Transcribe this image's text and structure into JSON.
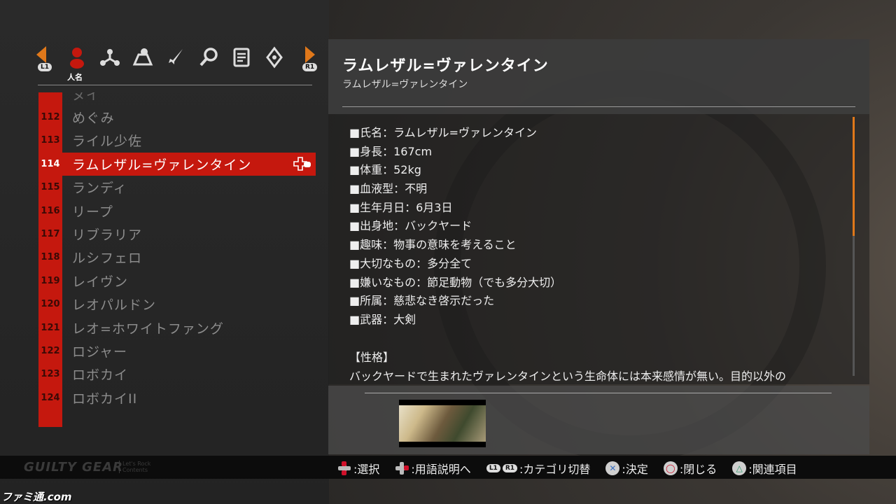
{
  "category_nav": {
    "left_button": "L1",
    "right_button": "R1",
    "active_label": "人名",
    "icons": [
      "person-icon",
      "network-icon",
      "map-icon",
      "sword-icon",
      "magnifier-icon",
      "document-icon",
      "hand-sign-icon"
    ]
  },
  "glossary_list": {
    "partial_top": "ヌイ",
    "items": [
      {
        "num": "112",
        "name": "めぐみ"
      },
      {
        "num": "113",
        "name": "ライル少佐"
      },
      {
        "num": "114",
        "name": "ラムレザル=ヴァレンタイン",
        "selected": true
      },
      {
        "num": "115",
        "name": "ランディ"
      },
      {
        "num": "116",
        "name": "リープ"
      },
      {
        "num": "117",
        "name": "リブラリア"
      },
      {
        "num": "118",
        "name": "ルシフェロ"
      },
      {
        "num": "119",
        "name": "レイヴン"
      },
      {
        "num": "120",
        "name": "レオパルドン"
      },
      {
        "num": "121",
        "name": "レオ=ホワイトファング"
      },
      {
        "num": "122",
        "name": "ロジャー"
      },
      {
        "num": "123",
        "name": "ロボカイ"
      },
      {
        "num": "124",
        "name": "ロボカイII"
      }
    ]
  },
  "detail": {
    "title": "ラムレザル=ヴァレンタイン",
    "subtitle": "ラムレザル=ヴァレンタイン",
    "attributes": [
      "■氏名：ラムレザル=ヴァレンタイン",
      "■身長：167cm",
      "■体重：52kg",
      "■血液型：不明",
      "■生年月日：6月3日",
      "■出身地：バックヤード",
      "■趣味：物事の意味を考えること",
      "■大切なもの：多分全て",
      "■嫌いなもの：節足動物（でも多分大切）",
      "■所属：慈悲なき啓示だった",
      "■武器：大剣"
    ],
    "section_heading": "【性格】",
    "section_text": "バックヤードで生まれたヴァレンタインという生命体には本来感情が無い。目的以外の"
  },
  "footer": {
    "logo": "GUILTY GEAR",
    "logo_sub_1": "Let's Rock",
    "logo_sub_2": "Contents",
    "controls": [
      {
        "label": ":選択"
      },
      {
        "label": ":用語説明へ"
      },
      {
        "label": ":カテゴリ切替"
      },
      {
        "label": ":決定"
      },
      {
        "label": ":閉じる"
      },
      {
        "label": ":関連項目"
      }
    ]
  },
  "watermark": "ファミ通.com",
  "colors": {
    "accent_red": "#c5180e",
    "accent_orange": "#e0781a"
  }
}
